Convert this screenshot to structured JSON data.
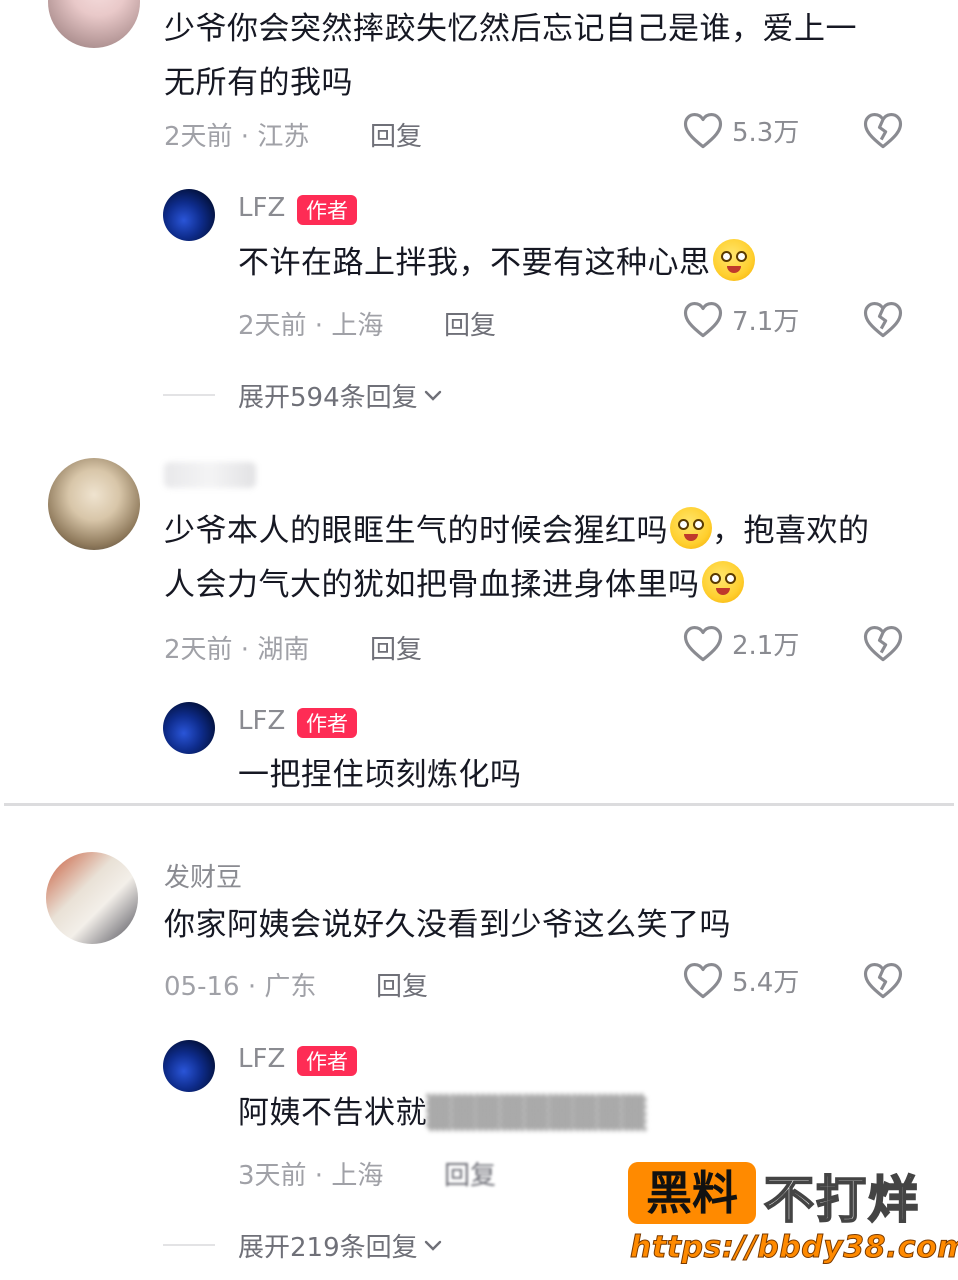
{
  "comments": [
    {
      "content": "少爷你会突然摔跤失忆然后忘记自己是谁，爱上一无所有的我吗",
      "content_line1": "少爷你会突然摔跤失忆然后忘记自己是谁，爱上一",
      "content_line2": "无所有的我吗",
      "meta": "2天前 · 江苏",
      "reply_label": "回复",
      "likes": "5.3万",
      "reply": {
        "username": "LFZ",
        "badge": "作者",
        "content": "不许在路上拌我，不要有这种心思",
        "meta": "2天前 · 上海",
        "reply_label": "回复",
        "likes": "7.1万"
      },
      "expand_label": "展开594条回复"
    },
    {
      "content_line1": "少爷本人的眼眶生气的时候会猩红吗",
      "content_line1_tail": "，抱喜欢的",
      "content_line2": "人会力气大的犹如把骨血揉进身体里吗",
      "meta": "2天前 · 湖南",
      "reply_label": "回复",
      "likes": "2.1万",
      "reply": {
        "username": "LFZ",
        "badge": "作者",
        "content": "一把捏住顷刻炼化吗"
      }
    },
    {
      "username": "发财豆",
      "content": "你家阿姨会说好久没看到少爷这么笑了吗",
      "meta": "05-16 · 广东",
      "reply_label": "回复",
      "likes": "5.4万",
      "reply": {
        "username": "LFZ",
        "badge": "作者",
        "content": "阿姨不告状就",
        "meta": "3天前 · 上海",
        "reply_label": "回复"
      },
      "expand_label": "展开219条回复"
    }
  ],
  "watermark": {
    "badge": "黑料",
    "text": "不打烊",
    "url": "https://bbdy38.com"
  },
  "icons": {
    "like": "heart-outline-icon",
    "dislike": "broken-heart-icon",
    "expand": "chevron-down-icon"
  }
}
